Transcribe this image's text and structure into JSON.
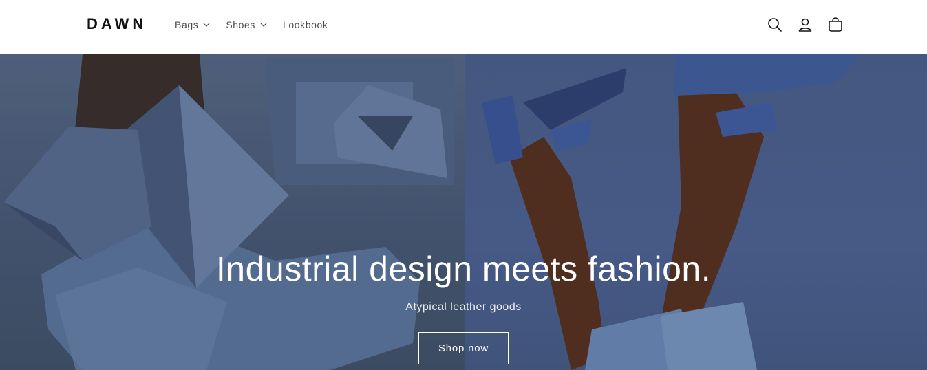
{
  "header": {
    "logo": "DAWN",
    "nav": [
      {
        "label": "Bags",
        "has_dropdown": true
      },
      {
        "label": "Shoes",
        "has_dropdown": true
      },
      {
        "label": "Lookbook",
        "has_dropdown": false
      }
    ],
    "icons": [
      "search-icon",
      "account-icon",
      "cart-icon"
    ]
  },
  "hero": {
    "title": "Industrial design meets fashion.",
    "subtitle": "Atypical leather goods",
    "button_label": "Shop now"
  },
  "colors": {
    "header_bg": "#ffffff",
    "text_dark": "#121212",
    "nav_text": "#4a4a4a",
    "hero_blue": "#4d6491",
    "hero_text": "#ffffff"
  }
}
